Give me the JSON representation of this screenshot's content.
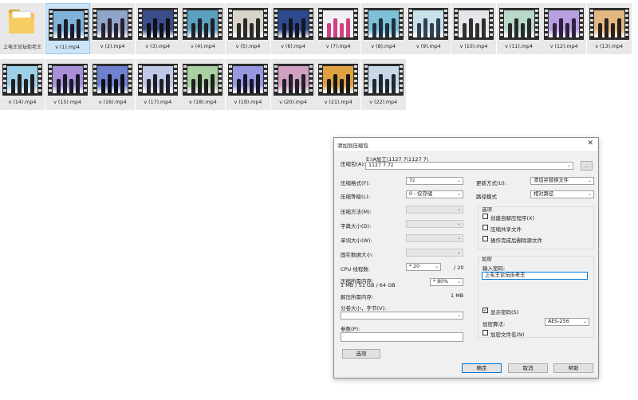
{
  "folder": {
    "name": "上电王论坛街老王"
  },
  "files": [
    "v (1).mp4",
    "v (2).mp4",
    "v (3).mp4",
    "v (4).mp4",
    "v (5).mp4",
    "v (6).mp4",
    "v (7).mp4",
    "v (8).mp4",
    "v (9).mp4",
    "v (10).mp4",
    "v (11).mp4",
    "v (12).mp4",
    "v (13).mp4",
    "v (14).mp4",
    "v (15).mp4",
    "v (16).mp4",
    "v (17).mp4",
    "v (18).mp4",
    "v (19).mp4",
    "v (20).mp4",
    "v (21).mp4",
    "v (22).mp4"
  ],
  "dialog": {
    "title": "添加到压缩包",
    "archive_label": "压缩包(A):",
    "archive_path": "E:\\A加工\\1127 7\\1127 7\\",
    "archive_name": "1127 7.7z",
    "browse": "...",
    "format_label": "压缩格式(F):",
    "format_value": "7z",
    "level_label": "压缩等级(L):",
    "level_value": "0 - 仅存储",
    "method_label": "压缩方法(M):",
    "dict_label": "字典大小(D):",
    "word_label": "单词大小(W):",
    "solid_label": "固实数据大小:",
    "cpu_label": "CPU 线程数:",
    "cpu_value": "* 20",
    "cpu_max": "/ 20",
    "mem_label": "压缩所需内存:",
    "mem_detail": "1 MB / 51 GB / 64 GB",
    "mem_pct": "* 80%",
    "dmem_label": "解压所需内存:",
    "dmem_value": "1 MB",
    "split_label": "分卷大小，字节(V):",
    "param_label": "参数(P):",
    "options_btn": "选项",
    "update_label": "更新方式(U):",
    "update_value": "添加并替换文件",
    "path_label": "路径模式",
    "path_value": "相对路径",
    "opts_group": "选项",
    "opt1": "创建自解压程序(X)",
    "opt2": "压缩共享文件",
    "opt3": "操作完成后删除源文件",
    "enc_group": "加密",
    "pwd_label": "输入密码:",
    "pwd_value": "上毛王论坛街老王",
    "show_pwd": "显示密码(S)",
    "show_pwd_checked": "✓",
    "enc_method_label": "加密算法:",
    "enc_method_value": "AES-256",
    "enc_names": "加密文件名(N)",
    "ok": "确定",
    "cancel": "取消",
    "help": "帮助"
  }
}
